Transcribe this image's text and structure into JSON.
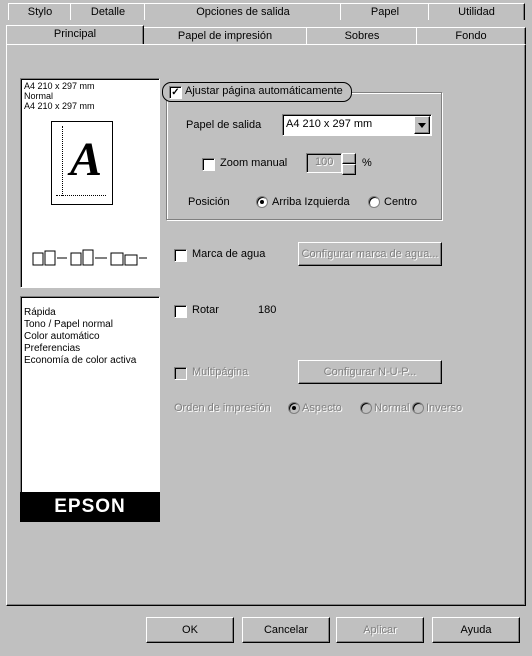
{
  "tabs_back": [
    {
      "label": "Stylo"
    },
    {
      "label": "Detalle"
    },
    {
      "label": "Opciones de salida"
    },
    {
      "label": "Papel"
    },
    {
      "label": "Utilidad"
    }
  ],
  "tabs_front": [
    {
      "label": "Principal"
    },
    {
      "label": "Papel de impresión"
    },
    {
      "label": "Sobres"
    },
    {
      "label": "Fondo"
    }
  ],
  "summary": {
    "lines": [
      "A4 210 x 297 mm",
      "Normal",
      "A4 210 x 297 mm"
    ],
    "preview_letter": "A"
  },
  "settings_list": {
    "items": [
      "Rápida",
      "Tono / Papel normal",
      "Color automático",
      "Preferencias",
      "Economía de color activa"
    ]
  },
  "brand": "EPSON",
  "reduce_group": {
    "checkbox_label": "Ajustar página automáticamente",
    "checked": true,
    "paper_label": "Papel de salida",
    "paper_value": "A4 210 x 297 mm",
    "zoom_label": "Zoom manual",
    "zoom_checked": false,
    "zoom_value": "100",
    "zoom_unit": "%",
    "position_label": "Posición",
    "position_options": [
      "Arriba Izquierda",
      "Centro"
    ],
    "position_selected": 0
  },
  "watermark": {
    "checkbox_label": "Marca de agua",
    "checked": false,
    "button_label": "Configurar marca de agua..."
  },
  "rotate": {
    "checkbox_label": "Rotar",
    "checked": false,
    "value": "180"
  },
  "multipage": {
    "checkbox_label": "Multipágina",
    "checked": false,
    "button_label": "Configurar N-U-P...",
    "order_label": "Orden de impresión",
    "options": [
      "Aspecto",
      "Normal",
      "Inverso"
    ],
    "selected": 0
  },
  "footer": {
    "ok_label": "OK",
    "cancel_label": "Cancelar",
    "apply_label": "Aplicar",
    "help_label": "Ayuda"
  }
}
